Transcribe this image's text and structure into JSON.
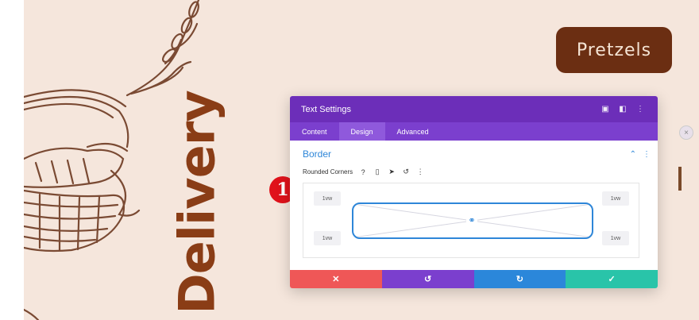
{
  "canvas": {
    "heading": "Delivery",
    "badge": "Pretzels"
  },
  "marker": {
    "label": "1"
  },
  "panel": {
    "title": "Text Settings",
    "header_icons": [
      "expand-icon",
      "layout-icon",
      "more-icon"
    ],
    "tabs": [
      {
        "label": "Content"
      },
      {
        "label": "Design"
      },
      {
        "label": "Advanced"
      }
    ],
    "active_tab": "Design",
    "section": {
      "title": "Border"
    },
    "rounded_corners": {
      "label": "Rounded Corners",
      "icons": [
        "help-icon",
        "mobile-icon",
        "hover-icon",
        "reset-icon",
        "options-icon"
      ],
      "values": {
        "top_left": "1vw",
        "top_right": "1vw",
        "bottom_left": "1vw",
        "bottom_right": "1vw"
      }
    },
    "footer": [
      "cancel-icon",
      "undo-icon",
      "redo-icon",
      "save-icon"
    ]
  },
  "colors": {
    "canvas_bg": "#f5e6dc",
    "accent_purple": "#6c2eb9",
    "link_blue": "#2e86d8",
    "cancel_red": "#ef5757",
    "save_green": "#29c4a9",
    "brand_brown": "#6b2e12"
  }
}
